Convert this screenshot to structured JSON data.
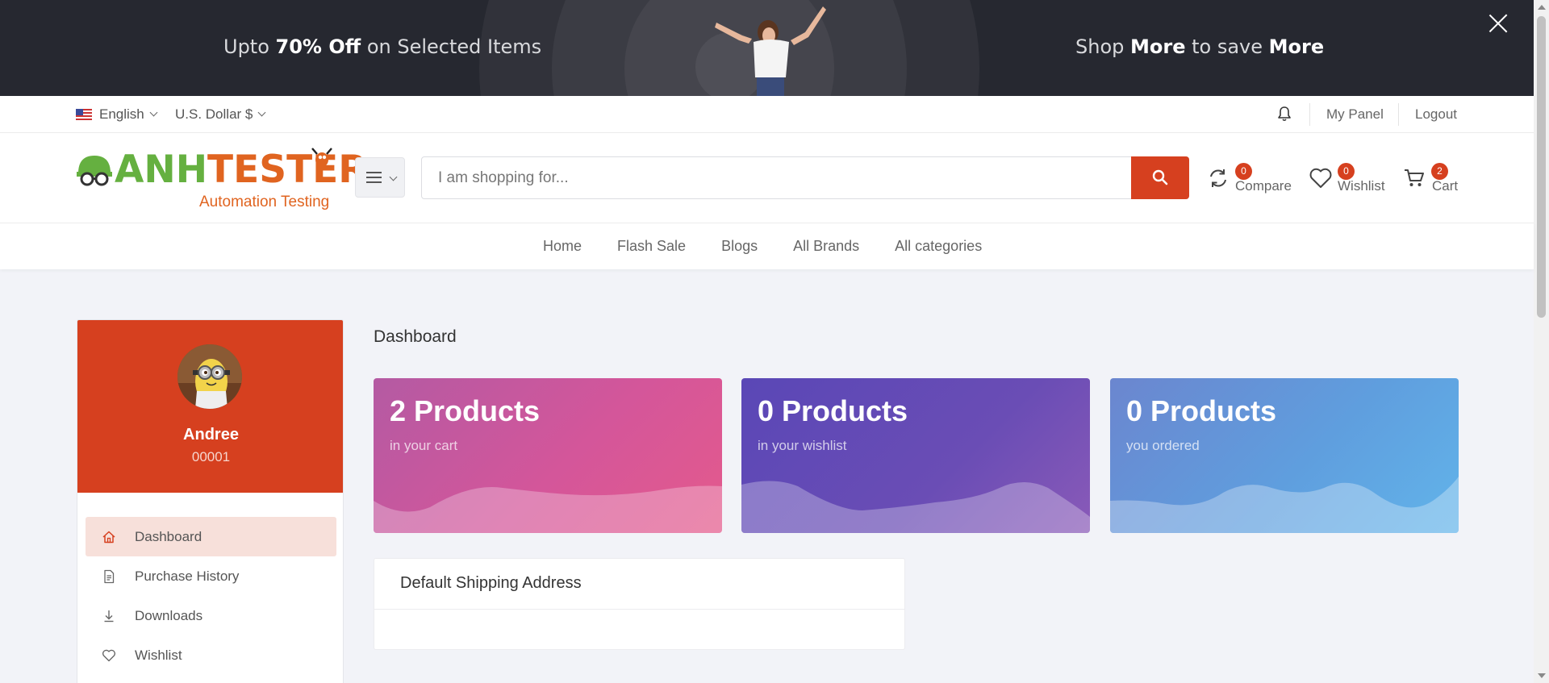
{
  "promo": {
    "left_pre": "Upto ",
    "left_bold": "70% Off",
    "left_post": " on Selected Items",
    "right_pre": "Shop ",
    "right_bold1": "More",
    "right_mid": " to save ",
    "right_bold2": "More",
    "bg_color": "#262830"
  },
  "topbar": {
    "language": "English",
    "currency": "U.S. Dollar $",
    "my_panel": "My Panel",
    "logout": "Logout"
  },
  "header": {
    "logo_green": "ANH",
    "logo_orange": "TESTER",
    "logo_sub": "Automation Testing",
    "search_placeholder": "I am shopping for...",
    "compare_label": "Compare",
    "compare_count": "0",
    "wishlist_label": "Wishlist",
    "wishlist_count": "0",
    "cart_label": "Cart",
    "cart_count": "2",
    "accent_color": "#d6401f"
  },
  "nav": {
    "items": [
      "Home",
      "Flash Sale",
      "Blogs",
      "All Brands",
      "All categories"
    ]
  },
  "sidebar": {
    "user_name": "Andree",
    "user_id": "00001",
    "items": [
      {
        "label": "Dashboard",
        "icon": "home-icon"
      },
      {
        "label": "Purchase History",
        "icon": "document-icon"
      },
      {
        "label": "Downloads",
        "icon": "download-icon"
      },
      {
        "label": "Wishlist",
        "icon": "heart-icon"
      }
    ]
  },
  "main": {
    "title": "Dashboard",
    "cards": [
      {
        "value": "2 Products",
        "caption": "in your cart"
      },
      {
        "value": "0 Products",
        "caption": "in your wishlist"
      },
      {
        "value": "0 Products",
        "caption": "you ordered"
      }
    ],
    "shipping_title": "Default Shipping Address"
  }
}
